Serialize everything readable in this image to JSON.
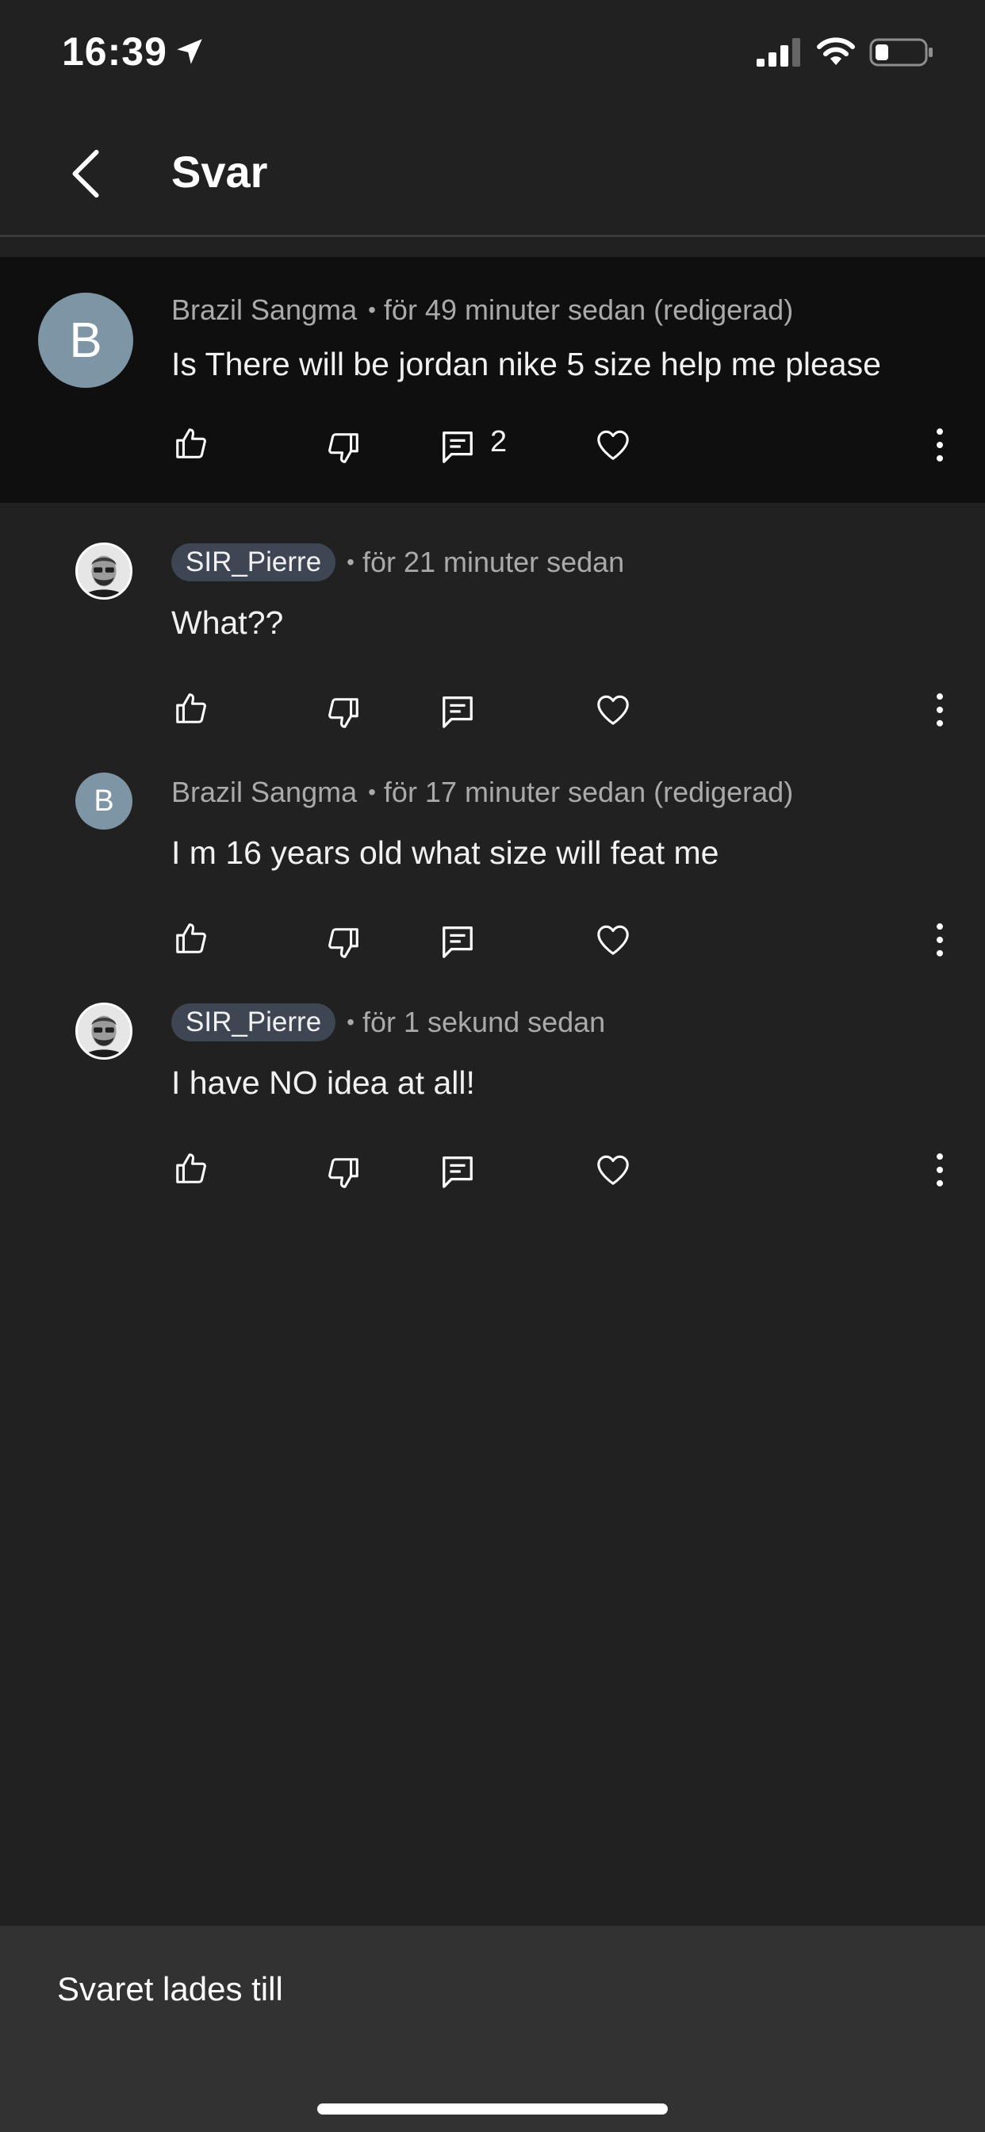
{
  "status_bar": {
    "time": "16:39"
  },
  "header": {
    "title": "Svar"
  },
  "comments": [
    {
      "author": "Brazil Sangma",
      "avatar_letter": "B",
      "timestamp": "för 49 minuter sedan (redigerad)",
      "text": "Is There will be jordan nike 5 size help me please",
      "reply_count": "2"
    },
    {
      "author": "SIR_Pierre",
      "timestamp": "för 21 minuter sedan",
      "text": "What??"
    },
    {
      "author": "Brazil Sangma",
      "avatar_letter": "B",
      "timestamp": "för 17 minuter sedan (redigerad)",
      "text": "I m 16 years old what size will feat me"
    },
    {
      "author": "SIR_Pierre",
      "timestamp": "för 1 sekund sedan",
      "text": "I have NO idea at all!"
    }
  ],
  "separator": "•",
  "toast": {
    "message": "Svaret lades till"
  },
  "colors": {
    "background": "#212121",
    "highlight_background": "#0f0f0f",
    "avatar_letter_bg": "#7e95a5",
    "author_chip_bg": "#3e4654",
    "toast_bg": "#323232"
  }
}
